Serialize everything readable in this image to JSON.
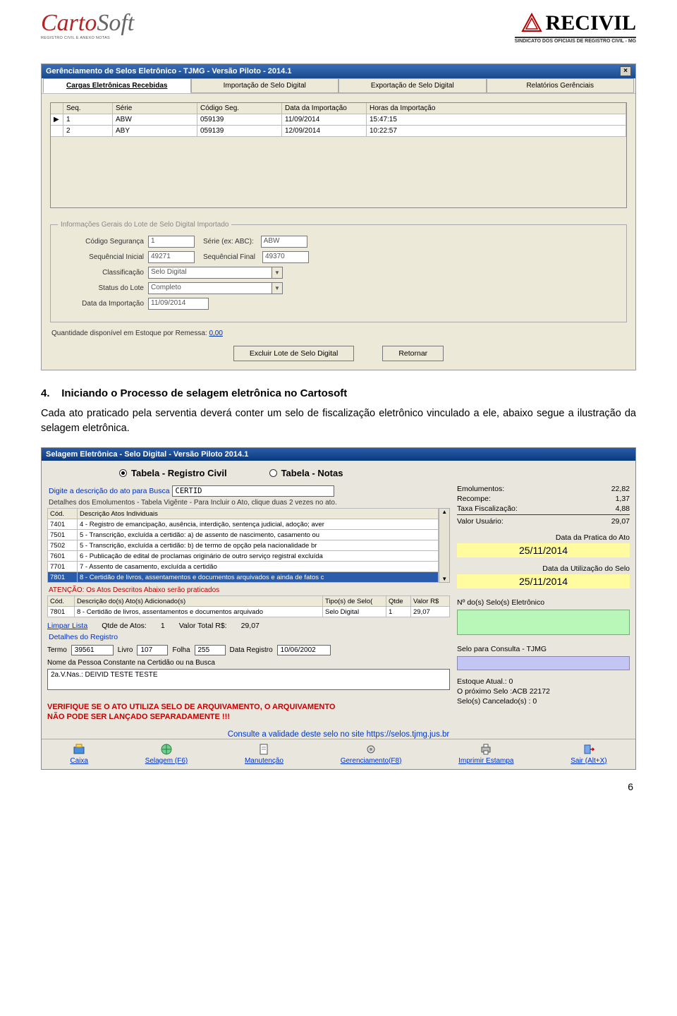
{
  "header": {
    "logo_carto": "Carto",
    "logo_soft": "Soft",
    "logo_sub": "REGISTRO CIVIL E ANEXO NOTAS",
    "recivil": "RECIVIL",
    "recivil_sub": "SINDICATO DOS OFICIAIS DE REGISTRO CIVIL - MG"
  },
  "win1": {
    "title": "Gerênciamento de Selos Eletrônico - TJMG  - Versão Piloto - 2014.1",
    "tabs": [
      "Cargas Eletrônicas Recebidas",
      "Importação de Selo Digital",
      "Exportação de Selo Digital",
      "Relatórios Gerênciais"
    ],
    "grid_headers": [
      "Seq.",
      "Série",
      "Código Seg.",
      "Data da Importação",
      "Horas da Importação"
    ],
    "rows": [
      {
        "marker": "▶",
        "seq": "1",
        "serie": "ABW",
        "cod": "059139",
        "data": "11/09/2014",
        "hora": "15:47:15"
      },
      {
        "marker": "",
        "seq": "2",
        "serie": "ABY",
        "cod": "059139",
        "data": "12/09/2014",
        "hora": "10:22:57"
      }
    ],
    "fieldset_legend": "Informações Gerais do Lote de Selo Digital Importado",
    "lbl_cod": "Código Segurança",
    "val_cod": "1",
    "lbl_serie": "Série (ex: ABC):",
    "val_serie": "ABW",
    "lbl_seqi": "Sequêncial Inicial",
    "val_seqi": "49271",
    "lbl_seqf": "Sequêncial  Final",
    "val_seqf": "49370",
    "lbl_class": "Classificação",
    "val_class": "Selo Digital",
    "lbl_status": "Status do Lote",
    "val_status": "Completo",
    "lbl_dataimp": "Data da Importação",
    "val_dataimp": "11/09/2014",
    "estoque_label": "Quantidade disponível em Estoque por Remessa:",
    "estoque_val": "0,00",
    "btn_excluir": "Excluir Lote de Selo Digital",
    "btn_retornar": "Retornar"
  },
  "body_text": {
    "heading_num": "4.",
    "heading": "Iniciando o Processo de selagem eletrônica no Cartosoft",
    "para": "Cada ato praticado pela serventia deverá conter um selo de fiscalização eletrônico vinculado a ele, abaixo segue a ilustração da selagem eletrônica."
  },
  "win2": {
    "title": "Selagem Eletrônica - Selo Digital - Versão Piloto 2014.1",
    "radio_a": "Tabela - Registro Civil",
    "radio_b": "Tabela - Notas",
    "search_label": "Digite a descrição do ato para Busca",
    "search_val": "CERTID",
    "subhint": "Detalhes dos Emolumentos - Tabela Vigênte - Para Incluir o Ato, clique duas 2 vezes no ato.",
    "tbl_headers": [
      "Cód.",
      "Descrição Atos Individuais"
    ],
    "tbl_rows": [
      {
        "cod": "7401",
        "desc": "4 - Registro de emancipação, ausência, interdição, sentença judicial, adoção; aver"
      },
      {
        "cod": "7501",
        "desc": "5 - Transcrição, excluída a certidão:   a) de assento de nascimento, casamento ou"
      },
      {
        "cod": "7502",
        "desc": "5 - Transcrição, excluída a certidão:   b) de termo de opção pela nacionalidade br"
      },
      {
        "cod": "7601",
        "desc": "6 - Publicação de edital de proclamas originário de outro serviço registral excluída"
      },
      {
        "cod": "7701",
        "desc": "7 - Assento de casamento, excluída a certidão"
      },
      {
        "cod": "7801",
        "desc": "8 - Certidão de livros, assentamentos e documentos arquivados e ainda de fatos c",
        "sel": true
      }
    ],
    "atenc": "ATENÇÃO: Os Atos Descritos Abaixo serão praticados",
    "tbl2_headers": [
      "Cód.",
      "Descrição do(s) Ato(s) Adicionado(s)",
      "Tipo(s) de Selo(",
      "Qtde",
      "Valor R$"
    ],
    "tbl2_row": {
      "cod": "7801",
      "desc": "8 - Certidão de livros, assentamentos e documentos arquivado",
      "tipo": "Selo Digital",
      "qtde": "1",
      "valor": "29,07"
    },
    "limpar": "Limpar Lista",
    "qtde_label": "Qtde de Atos:",
    "qtde_val": "1",
    "tot_label": "Valor Total R$:",
    "tot_val": "29,07",
    "detreg": "Detalhes do Registro",
    "r_termo_l": "Termo",
    "r_termo": "39561",
    "r_livro_l": "Livro",
    "r_livro": "107",
    "r_folha_l": "Folha",
    "r_folha": "255",
    "r_data_l": "Data Registro",
    "r_data": "10/06/2002",
    "r_nome_l": "Nome da Pessoa Constante na Certidão ou na Busca",
    "r_nome": "2a.V.Nas.: DEIVID TESTE TESTE",
    "warn1": "VERIFIQUE SE O ATO UTILIZA SELO DE ARQUIVAMENTO, O ARQUIVAMENTO",
    "warn2": "NÃO PODE SER LANÇADO SEPARADAMENTE !!!",
    "consult": "Consulte a validade deste selo no site https://selos.tjmg.jus.br",
    "kv": [
      {
        "l": "Emolumentos:",
        "v": "22,82"
      },
      {
        "l": "Recompe:",
        "v": "1,37"
      },
      {
        "l": "Taxa Fiscalização:",
        "v": "4,88",
        "red": true
      },
      {
        "l": "Valor Usuário:",
        "v": "29,07"
      }
    ],
    "date1_l": "Data da Pratica do Ato",
    "date1": "25/11/2014",
    "date2_l": "Data da Utilização do Selo",
    "date2": "25/11/2014",
    "selo_n_l": "Nº do(s) Selo(s) Eletrônico",
    "selo_c_l": "Selo para Consulta - TJMG",
    "estq_l": "Estoque Atual.: 0",
    "prox": "O próximo Selo :ACB 22172",
    "canc": "Selo(s) Cancelado(s) : 0",
    "toolbar": [
      {
        "l": "Caixa"
      },
      {
        "l": "Selagem (F6)"
      },
      {
        "l": "Manutenção"
      },
      {
        "l": "Gerenciamento(F8)"
      },
      {
        "l": "Imprimir Estampa"
      },
      {
        "l": "Sair (Alt+X)"
      }
    ]
  },
  "page_number": "6"
}
